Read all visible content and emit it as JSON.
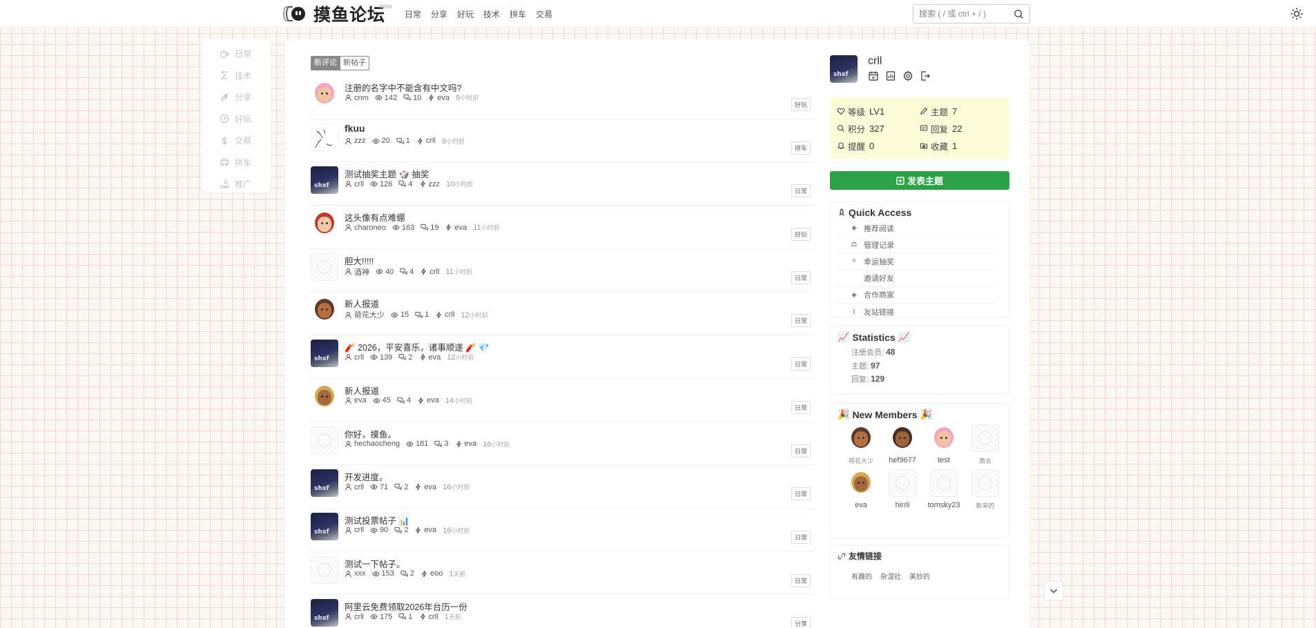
{
  "header": {
    "logo_title": "摸鱼论坛",
    "logo_badge": "beta",
    "nav": [
      "日常",
      "分享",
      "好玩",
      "技术",
      "拼车",
      "交易"
    ],
    "search_placeholder": "搜索 ( / 或 ctrl + / )"
  },
  "sidebar": {
    "items": [
      {
        "label": "日常",
        "icon": "coffee-icon"
      },
      {
        "label": "技术",
        "icon": "sigma-icon"
      },
      {
        "label": "分享",
        "icon": "rocket-icon"
      },
      {
        "label": "好玩",
        "icon": "gauge-icon"
      },
      {
        "label": "交易",
        "icon": "dollar-icon"
      },
      {
        "label": "拼车",
        "icon": "car-icon"
      },
      {
        "label": "推广",
        "icon": "hand-coin-icon"
      }
    ]
  },
  "tabs": {
    "active": "新评论",
    "inactive": "新帖子"
  },
  "posts": [
    {
      "title": "注册的名字中不能含有中文吗?",
      "author": "cnm",
      "views": "142",
      "replies": "10",
      "last": "eva",
      "time": "9",
      "unit": "小时前",
      "tag": "好玩",
      "avatar": "face-pink",
      "big": false
    },
    {
      "title": "fkuu",
      "author": "zzz",
      "views": "20",
      "replies": "1",
      "last": "crll",
      "time": "9",
      "unit": "小时前",
      "tag": "拼车",
      "avatar": "sketch",
      "big": true
    },
    {
      "title": "测试抽奖主题 🎲 抽奖",
      "author": "crll",
      "views": "126",
      "replies": "4",
      "last": "zzz",
      "time": "10",
      "unit": "小时前",
      "tag": "日常",
      "avatar": "dark",
      "big": false
    },
    {
      "title": "这头像有点难绷",
      "author": "charoneo",
      "views": "163",
      "replies": "19",
      "last": "eva",
      "time": "11",
      "unit": "小时前",
      "tag": "好玩",
      "avatar": "face-red",
      "big": false
    },
    {
      "title": "胆大!!!!!",
      "author": "酒神",
      "views": "40",
      "replies": "4",
      "last": "crll",
      "time": "11",
      "unit": "小时前",
      "tag": "日常",
      "avatar": "blank",
      "big": false
    },
    {
      "title": "新人报道",
      "author": "荷花大少",
      "views": "15",
      "replies": "1",
      "last": "crll",
      "time": "12",
      "unit": "小时前",
      "tag": "日常",
      "avatar": "face-brown",
      "big": false
    },
    {
      "title": "🧨 2026，平安喜乐，诸事顺遂 🧨 💎",
      "author": "crll",
      "views": "139",
      "replies": "2",
      "last": "eva",
      "time": "12",
      "unit": "小时前",
      "tag": "日常",
      "avatar": "dark",
      "big": false
    },
    {
      "title": "新人报道",
      "author": "eva",
      "views": "45",
      "replies": "4",
      "last": "eva",
      "time": "14",
      "unit": "小时前",
      "tag": "日常",
      "avatar": "face-blonde",
      "big": false
    },
    {
      "title": "你好，摸鱼。",
      "author": "hechaocheng",
      "views": "181",
      "replies": "3",
      "last": "eva",
      "time": "16",
      "unit": "小时前",
      "tag": "日常",
      "avatar": "blank",
      "big": false
    },
    {
      "title": "开发进度。",
      "author": "crll",
      "views": "71",
      "replies": "2",
      "last": "eva",
      "time": "16",
      "unit": "小时前",
      "tag": "日常",
      "avatar": "dark",
      "big": false
    },
    {
      "title": "测试投票帖子 📊",
      "author": "crll",
      "views": "90",
      "replies": "2",
      "last": "eva",
      "time": "16",
      "unit": "小时前",
      "tag": "日常",
      "avatar": "dark",
      "big": false
    },
    {
      "title": "测试一下帖子。",
      "author": "xxx",
      "views": "153",
      "replies": "2",
      "last": "eoo",
      "time": "1",
      "unit": "天前",
      "tag": "日常",
      "avatar": "blank",
      "big": false
    },
    {
      "title": "阿里云免费领取2026年台历一份",
      "author": "crll",
      "views": "175",
      "replies": "1",
      "last": "crll",
      "time": "1",
      "unit": "天前",
      "tag": "分享",
      "avatar": "dark",
      "big": false
    }
  ],
  "user": {
    "name": "crll",
    "stats": {
      "level_label": "等级",
      "level_value": "LV1",
      "topics_label": "主题",
      "topics_value": "7",
      "points_label": "积分",
      "points_value": "327",
      "replies_label": "回复",
      "replies_value": "22",
      "reminders_label": "提醒",
      "reminders_value": "0",
      "favorites_label": "收藏",
      "favorites_value": "1"
    }
  },
  "new_post_button": "发表主题",
  "quick_access": {
    "title": "Quick Access",
    "items": [
      {
        "label": "推荐阅读",
        "icon": "gem-icon"
      },
      {
        "label": "管理记录",
        "icon": "scale-icon"
      },
      {
        "label": "幸运抽奖",
        "icon": "spark-icon"
      },
      {
        "label": "邀请好友",
        "icon": ""
      },
      {
        "label": "合作商家",
        "icon": "gem-icon"
      },
      {
        "label": "友站链接",
        "icon": "paperclip-icon"
      }
    ]
  },
  "statistics": {
    "title": "Statistics",
    "members_label": "注册会员:",
    "members_value": "48",
    "topics_label": "主题:",
    "topics_value": "97",
    "replies_label": "回复:",
    "replies_value": "129"
  },
  "new_members": {
    "title": "New Members",
    "items": [
      {
        "name": "荷花大少",
        "avatar": "face-brown",
        "small": true
      },
      {
        "name": "hef9677",
        "avatar": "face-darkhair",
        "small": false
      },
      {
        "name": "test",
        "avatar": "face-pink",
        "small": false
      },
      {
        "name": "萧炎",
        "avatar": "blank",
        "small": true
      },
      {
        "name": "eva",
        "avatar": "face-blonde",
        "small": false
      },
      {
        "name": "hirrli",
        "avatar": "blank",
        "small": false
      },
      {
        "name": "tomsky23",
        "avatar": "blank",
        "small": false
      },
      {
        "name": "新来的",
        "avatar": "blank",
        "small": true
      }
    ]
  },
  "friend_links": {
    "title": "友情链接",
    "items": [
      "有趣的",
      "杂湿社",
      "美妙的"
    ]
  },
  "colors": {
    "accent_green": "#2ba245",
    "stats_bg": "#fdfcd8",
    "grid_line": "#ecdcd2"
  }
}
